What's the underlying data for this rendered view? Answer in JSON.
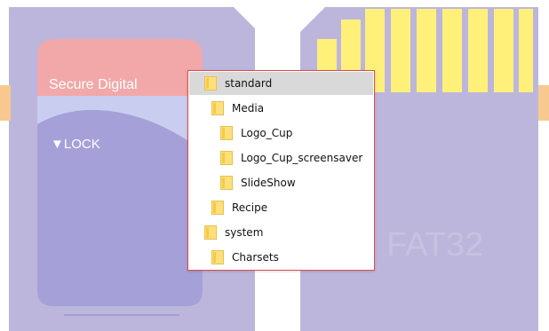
{
  "card_left": {
    "label_brand": "Secure Digital",
    "label_lock": "▼LOCK"
  },
  "card_right": {
    "label_format": "FAT32"
  },
  "colors": {
    "card_body": "#bcb6dc",
    "card_band": "#f2a8a8",
    "card_light": "#c9cdf0",
    "card_pads": "#fff07a",
    "side_tab": "#f7c98e",
    "tree_border": "#e14a4a",
    "folder_fill": "#fde07a",
    "selected_row": "#d9d9d9"
  },
  "tree": {
    "items": [
      {
        "label": "standard",
        "level": 0,
        "selected": true
      },
      {
        "label": "Media",
        "level": 1,
        "selected": false
      },
      {
        "label": "Logo_Cup",
        "level": 2,
        "selected": false
      },
      {
        "label": "Logo_Cup_screensaver",
        "level": 2,
        "selected": false
      },
      {
        "label": "SlideShow",
        "level": 2,
        "selected": false
      },
      {
        "label": "Recipe",
        "level": 1,
        "selected": false
      },
      {
        "label": "system",
        "level": 0,
        "selected": false
      },
      {
        "label": "Charsets",
        "level": 1,
        "selected": false
      }
    ]
  }
}
